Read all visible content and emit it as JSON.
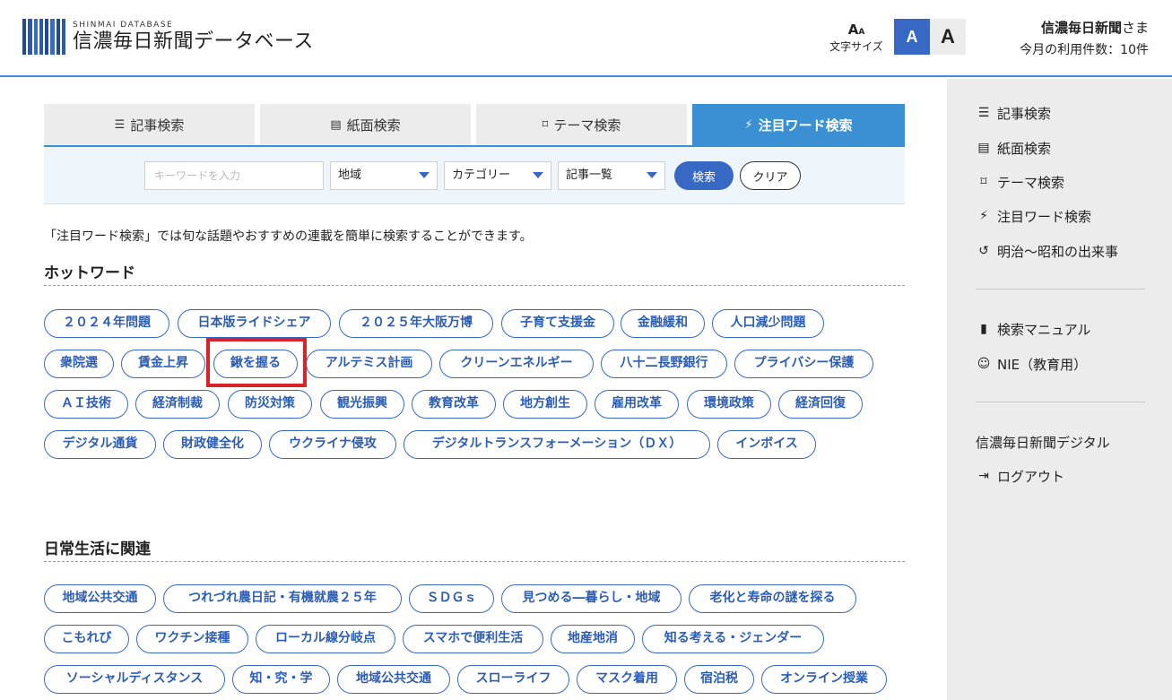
{
  "header": {
    "logo_sub": "SHINMAI DATABASE",
    "logo_main": "信濃毎日新聞データベース",
    "font_size_icon_big": "A",
    "font_size_icon_small": "A",
    "font_size_label": "文字サイズ",
    "font_small_btn": "A",
    "font_large_btn": "A",
    "user_name": "信濃毎日新聞",
    "user_suffix": "さま",
    "usage": "今月の利用件数：10件"
  },
  "tabs": [
    {
      "label": "記事検索",
      "icon": "list-icon"
    },
    {
      "label": "紙面検索",
      "icon": "newspaper-icon"
    },
    {
      "label": "テーマ検索",
      "icon": "bookmark-icon"
    },
    {
      "label": "注目ワード検索",
      "icon": "bolt-icon",
      "active": true
    }
  ],
  "search": {
    "keyword_placeholder": "キーワードを入力",
    "region": "地域",
    "category": "カテゴリー",
    "article_list": "記事一覧",
    "search_button": "検索",
    "clear_button": "クリア"
  },
  "description": "「注目ワード検索」では旬な話題やおすすめの連載を簡単に検索することができます。",
  "hot_words": {
    "title": "ホットワード",
    "tags": [
      "２０２４年問題",
      "日本版ライドシェア",
      "２０２５年大阪万博",
      "子育て支援金",
      "金融緩和",
      "人口減少問題",
      "衆院選",
      "賃金上昇",
      "鍬を握る",
      "アルテミス計画",
      "クリーンエネルギー",
      "八十二長野銀行",
      "プライバシー保護",
      "ＡＩ技術",
      "経済制裁",
      "防災対策",
      "観光振興",
      "教育改革",
      "地方創生",
      "雇用改革",
      "環境政策",
      "経済回復",
      "デジタル通貨",
      "財政健全化",
      "ウクライナ侵攻",
      "デジタルトランスフォーメーション（ＤＸ）",
      "インボイス"
    ]
  },
  "daily_life": {
    "title": "日常生活に関連",
    "tags": [
      "地域公共交通",
      "つれづれ農日記・有機就農２５年",
      "ＳＤＧｓ",
      "見つめる―暮らし・地域",
      "老化と寿命の謎を探る",
      "こもれび",
      "ワクチン接種",
      "ローカル線分岐点",
      "スマホで便利生活",
      "地産地消",
      "知る考える・ジェンダー",
      "ソーシャルディスタンス",
      "知・究・学",
      "地域公共交通",
      "スローライフ",
      "マスク着用",
      "宿泊税",
      "オンライン授業"
    ]
  },
  "sidebar": {
    "items": [
      {
        "label": "記事検索",
        "icon": "list-icon"
      },
      {
        "label": "紙面検索",
        "icon": "newspaper-icon"
      },
      {
        "label": "テーマ検索",
        "icon": "bookmark-icon"
      },
      {
        "label": "注目ワード検索",
        "icon": "bolt-icon"
      },
      {
        "label": "明治～昭和の出来事",
        "icon": "history-icon"
      },
      {
        "label": "検索マニュアル",
        "icon": "book-icon"
      },
      {
        "label": "NIE（教育用）",
        "icon": "student-icon"
      },
      {
        "label": "信濃毎日新聞デジタル",
        "icon": ""
      },
      {
        "label": "ログアウト",
        "icon": "logout-icon"
      }
    ]
  },
  "colors": {
    "accent": "#3b8fd3",
    "tag_border": "#3768c4",
    "highlight": "#d9232b"
  }
}
